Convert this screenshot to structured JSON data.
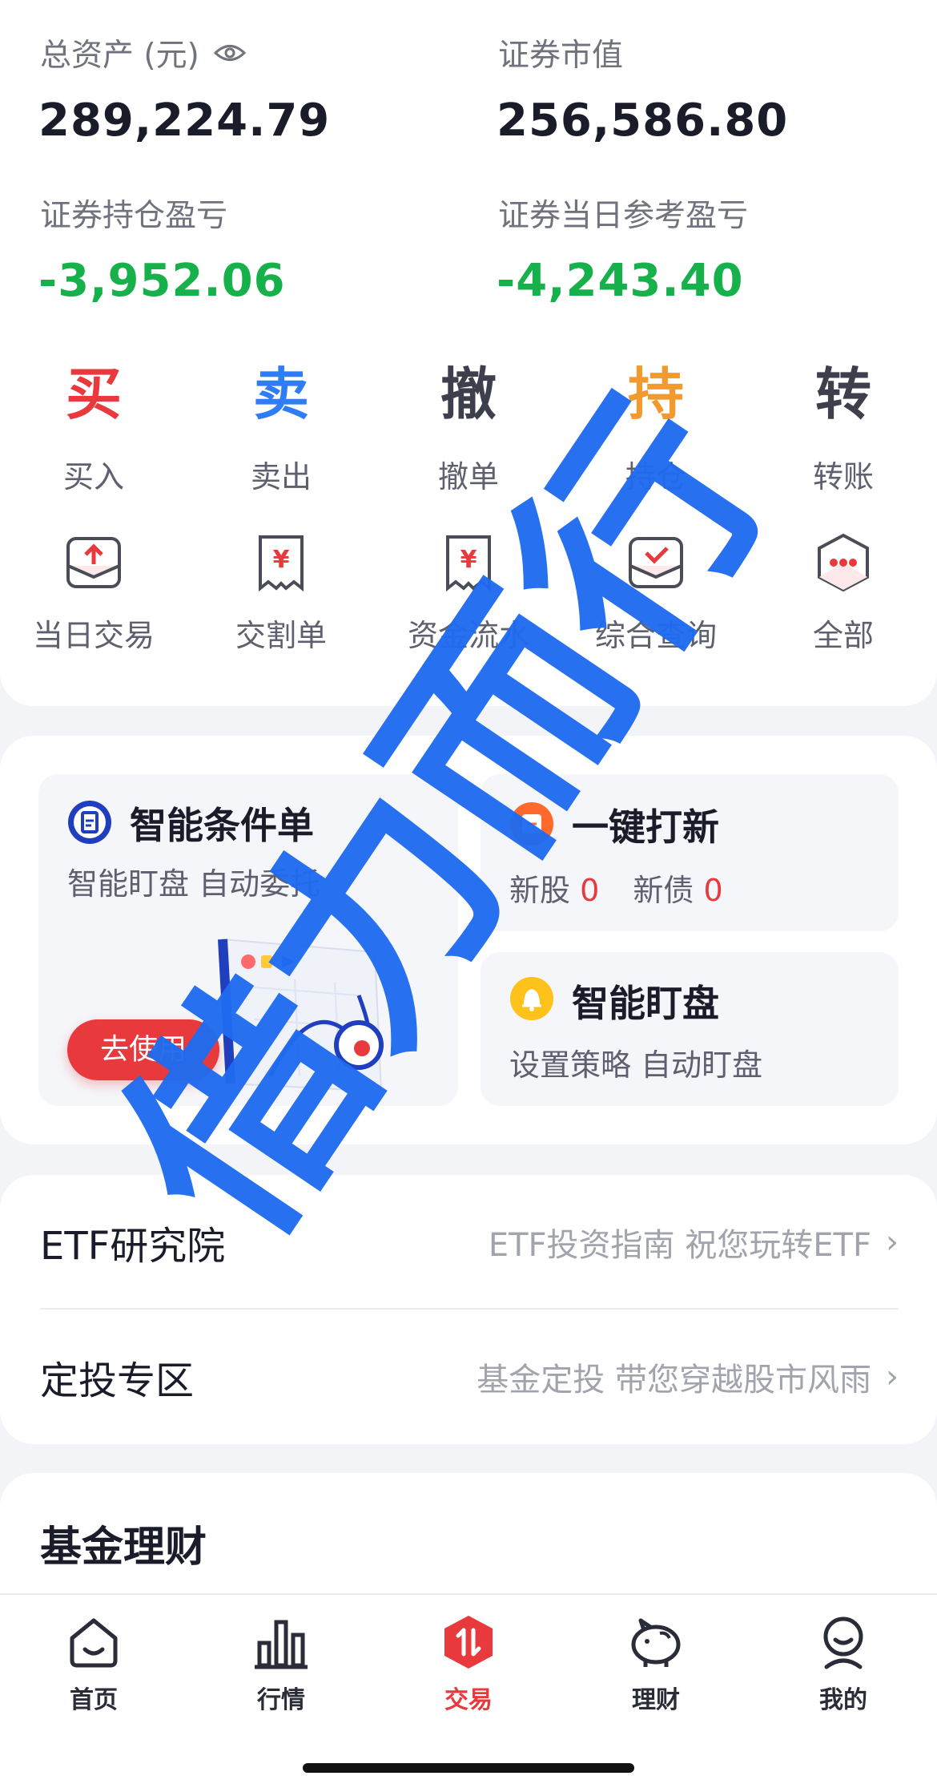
{
  "assets": {
    "total_label": "总资产 (元)",
    "total_value": "289,224.79",
    "market_label": "证券市值",
    "market_value": "256,586.80",
    "pnl_label": "证券持仓盈亏",
    "pnl_value": "-3,952.06",
    "day_pnl_label": "证券当日参考盈亏",
    "day_pnl_value": "-4,243.40"
  },
  "actions": [
    {
      "glyph": "买",
      "label": "买入",
      "color": "#e8393d"
    },
    {
      "glyph": "卖",
      "label": "卖出",
      "color": "#2e7df6"
    },
    {
      "glyph": "撤",
      "label": "撤单",
      "color": "#3d3f4c"
    },
    {
      "glyph": "持",
      "label": "持仓",
      "color": "#f29a2e"
    },
    {
      "glyph": "转",
      "label": "转账",
      "color": "#3d3f4c"
    }
  ],
  "quick": [
    {
      "label": "当日交易",
      "icon": "daily-trade-icon"
    },
    {
      "label": "交割单",
      "icon": "settlement-icon"
    },
    {
      "label": "资金流水",
      "icon": "fund-flow-icon"
    },
    {
      "label": "综合查询",
      "icon": "query-icon"
    },
    {
      "label": "全部",
      "icon": "more-icon"
    }
  ],
  "tools": {
    "smart_order_title": "智能条件单",
    "smart_order_sub": "智能盯盘 自动委托",
    "use_btn": "去使用",
    "ipo_title": "一键打新",
    "ipo_stock_label": "新股",
    "ipo_stock_count": "0",
    "ipo_bond_label": "新债",
    "ipo_bond_count": "0",
    "watch_title": "智能盯盘",
    "watch_sub": "设置策略 自动盯盘"
  },
  "links": [
    {
      "title": "ETF研究院",
      "desc": "ETF投资指南 祝您玩转ETF"
    },
    {
      "title": "定投专区",
      "desc": "基金定投 带您穿越股市风雨"
    }
  ],
  "fund_title": "基金理财",
  "tabs": [
    {
      "label": "首页",
      "icon": "home-icon"
    },
    {
      "label": "行情",
      "icon": "chart-icon"
    },
    {
      "label": "交易",
      "icon": "trade-icon",
      "active": true
    },
    {
      "label": "理财",
      "icon": "piggy-icon"
    },
    {
      "label": "我的",
      "icon": "user-icon"
    }
  ],
  "watermark": "借力而行",
  "colors": {
    "red": "#e8393d",
    "green": "#16b14a",
    "blue": "#2e7df6",
    "watermark": "#1f6bf0"
  }
}
